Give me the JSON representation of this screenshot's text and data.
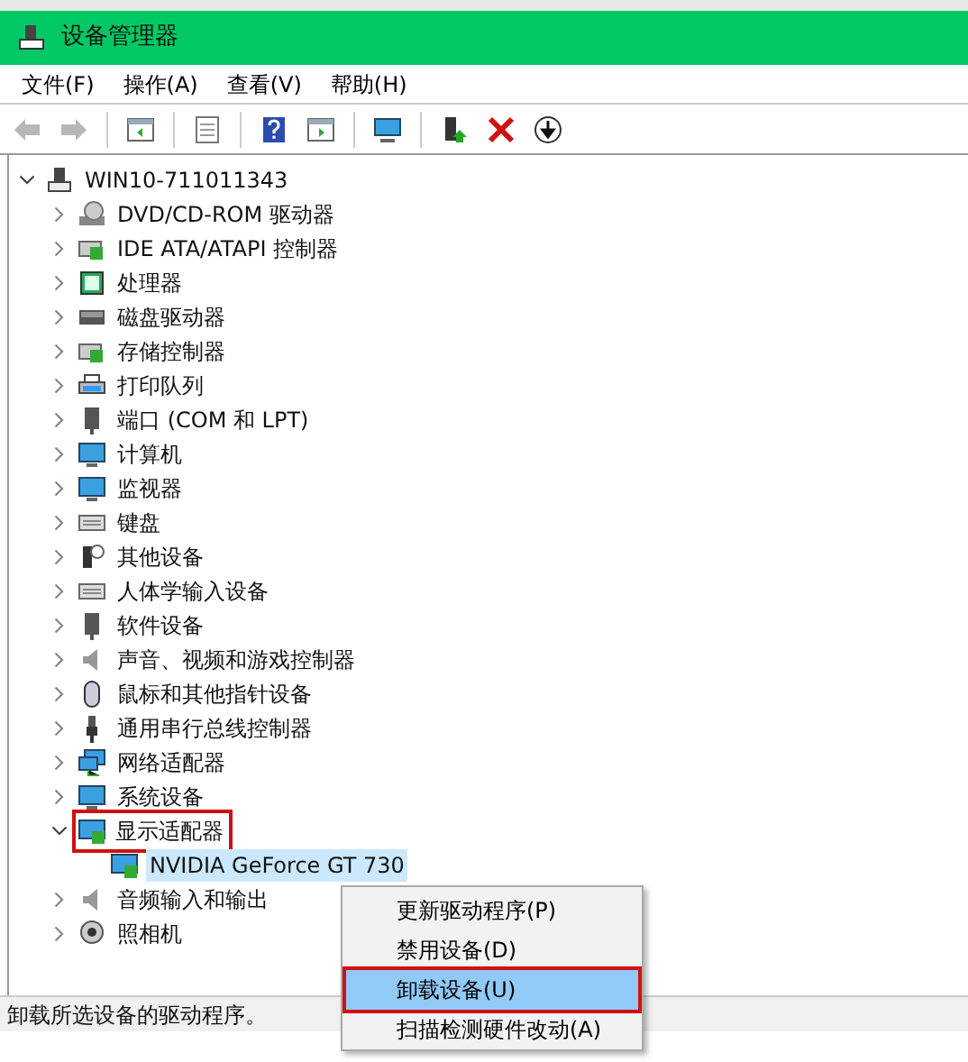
{
  "window": {
    "title": "设备管理器"
  },
  "menu_bar": [
    "文件(F)",
    "操作(A)",
    "查看(V)",
    "帮助(H)"
  ],
  "toolbar": [
    {
      "kind": "back",
      "disabled": true
    },
    {
      "kind": "forward",
      "disabled": true
    },
    {
      "kind": "sep"
    },
    {
      "kind": "panel"
    },
    {
      "kind": "sep"
    },
    {
      "kind": "props"
    },
    {
      "kind": "sep"
    },
    {
      "kind": "help"
    },
    {
      "kind": "run"
    },
    {
      "kind": "sep"
    },
    {
      "kind": "monitor"
    },
    {
      "kind": "sep"
    },
    {
      "kind": "update"
    },
    {
      "kind": "delete"
    },
    {
      "kind": "download"
    }
  ],
  "tree": {
    "label": "WIN10-711011343",
    "kind": "computer",
    "expanded": true,
    "children": [
      {
        "label": "DVD/CD-ROM 驱动器",
        "kind": "disc",
        "expanded": false
      },
      {
        "label": "IDE ATA/ATAPI 控制器",
        "kind": "board",
        "expanded": false
      },
      {
        "label": "处理器",
        "kind": "chip",
        "expanded": false
      },
      {
        "label": "磁盘驱动器",
        "kind": "disk",
        "expanded": false
      },
      {
        "label": "存储控制器",
        "kind": "board",
        "expanded": false
      },
      {
        "label": "打印队列",
        "kind": "printer",
        "expanded": false
      },
      {
        "label": "端口 (COM 和 LPT)",
        "kind": "port",
        "expanded": false
      },
      {
        "label": "计算机",
        "kind": "monitor",
        "expanded": false
      },
      {
        "label": "监视器",
        "kind": "monitor",
        "expanded": false
      },
      {
        "label": "键盘",
        "kind": "keyboard",
        "expanded": false
      },
      {
        "label": "其他设备",
        "kind": "unknown",
        "expanded": false
      },
      {
        "label": "人体学输入设备",
        "kind": "keyboard",
        "expanded": false
      },
      {
        "label": "软件设备",
        "kind": "port",
        "expanded": false
      },
      {
        "label": "声音、视频和游戏控制器",
        "kind": "speaker",
        "expanded": false
      },
      {
        "label": "鼠标和其他指针设备",
        "kind": "mouse",
        "expanded": false
      },
      {
        "label": "通用串行总线控制器",
        "kind": "usb",
        "expanded": false
      },
      {
        "label": "网络适配器",
        "kind": "network",
        "expanded": false
      },
      {
        "label": "系统设备",
        "kind": "monitor",
        "expanded": false
      },
      {
        "label": "显示适配器",
        "kind": "display",
        "expanded": true,
        "annotated": true,
        "children": [
          {
            "label": "NVIDIA GeForce GT 730",
            "kind": "display",
            "selected": true
          }
        ]
      },
      {
        "label": "音频输入和输出",
        "kind": "speaker",
        "expanded": false
      },
      {
        "label": "照相机",
        "kind": "camera",
        "expanded": false
      }
    ]
  },
  "context_menu": [
    {
      "label": "更新驱动程序(P)",
      "selected": false,
      "annotated": false
    },
    {
      "label": "禁用设备(D)",
      "selected": false,
      "annotated": false
    },
    {
      "label": "卸载设备(U)",
      "selected": true,
      "annotated": true
    },
    {
      "label": "扫描检测硬件改动(A)",
      "selected": false,
      "annotated": false
    }
  ],
  "status_bar": "卸载所选设备的驱动程序。"
}
